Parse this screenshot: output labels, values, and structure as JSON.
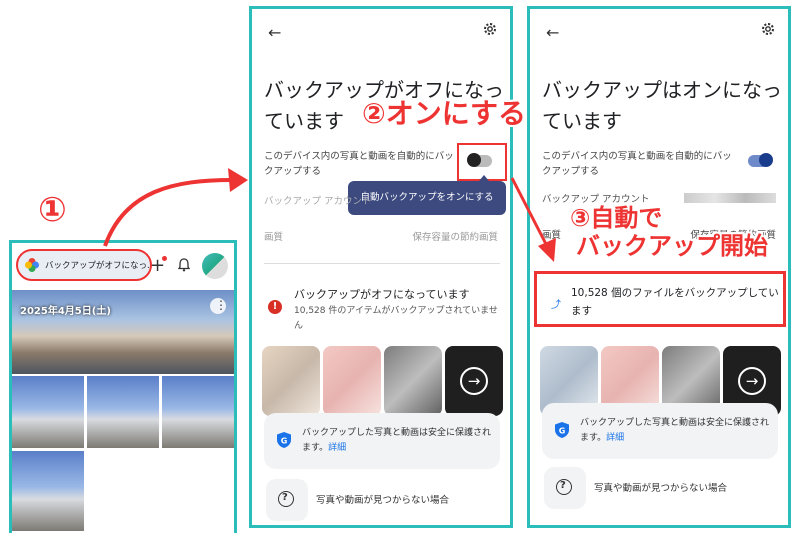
{
  "colors": {
    "frame": "#2bbdb9",
    "annotation": "#e33333",
    "tooltip": "#3c4a7f",
    "toggle_on": "#1a3c8c",
    "link": "#1a73e8"
  },
  "annotations": {
    "step1": "①",
    "step2": "②オンにする",
    "step3_line1": "③自動で",
    "step3_line2": "バックアップ開始"
  },
  "panel1": {
    "backup_chip_label": "バックアップがオフになっ...",
    "hero_date": "2025年4月5日(土)",
    "icons": [
      "photos-pinwheel-icon",
      "add-icon",
      "bell-icon",
      "avatar",
      "more-icon",
      "cloud-icon"
    ]
  },
  "panel2": {
    "title": "バックアップがオフになっています",
    "description": "このデバイス内の写真と動画を自動的にバックアップする",
    "tooltip": "自動バックアップをオンにする",
    "account_label": "バックアップ アカウント",
    "quality_label": "画質",
    "quality_value": "保存容量の節約画質",
    "status_title": "バックアップがオフになっています",
    "status_sub": "10,528 件のアイテムがバックアップされていません",
    "safe_text": "バックアップした写真と動画は安全に保護されます。",
    "safe_link": "詳細",
    "help_text": "写真や動画が見つからない場合"
  },
  "panel3": {
    "title": "バックアップはオンになっています",
    "description": "このデバイス内の写真と動画を自動的にバックアップする",
    "account_label": "バックアップ アカウント",
    "quality_label": "画質",
    "quality_value": "保存容量の節約画質",
    "progress_text": "10,528 個のファイルをバックアップしています",
    "safe_text": "バックアップした写真と動画は安全に保護されます。",
    "safe_link": "詳細",
    "help_text": "写真や動画が見つからない場合"
  }
}
